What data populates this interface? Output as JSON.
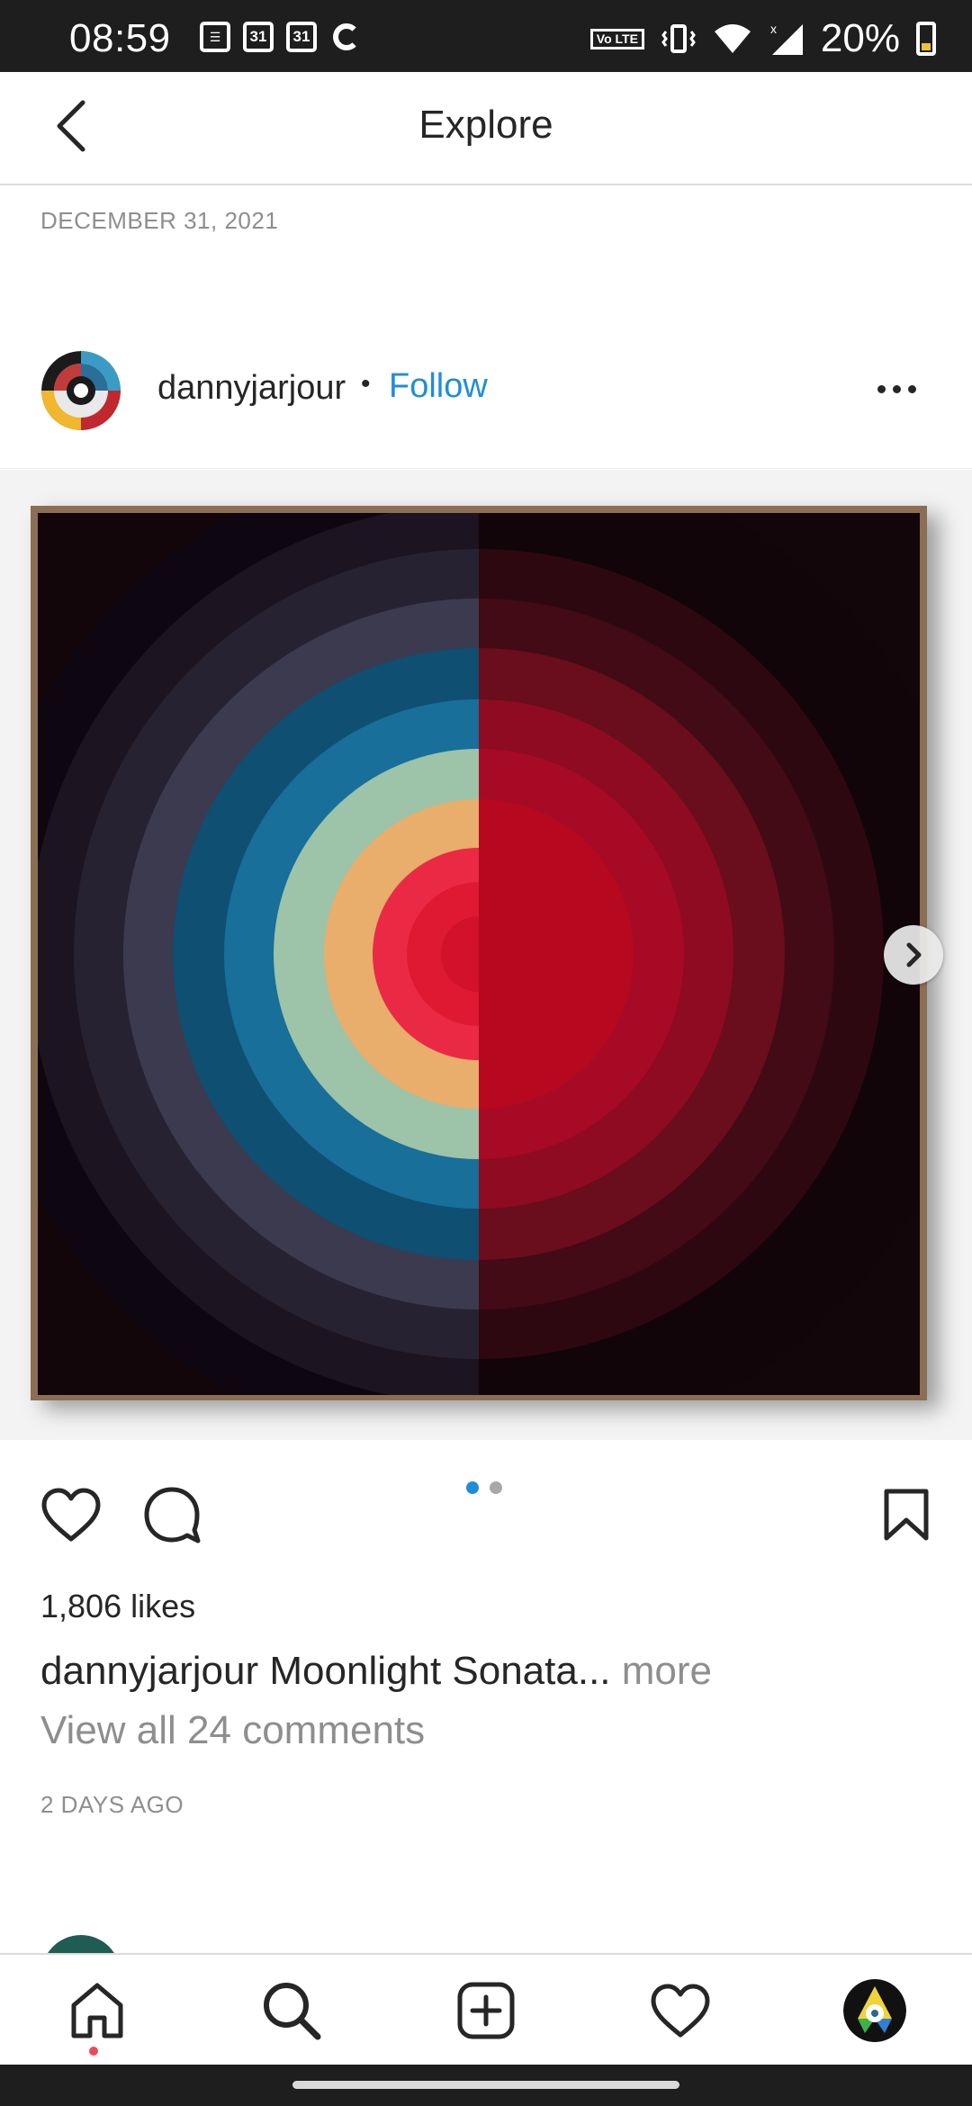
{
  "status_bar": {
    "time": "08:59",
    "calendar_day_1": "31",
    "calendar_day_2": "31",
    "lte_label": "Vo LTE",
    "battery": "20%"
  },
  "header": {
    "title": "Explore"
  },
  "feed": {
    "date": "DECEMBER 31, 2021"
  },
  "post": {
    "username": "dannyjarjour",
    "separator": "•",
    "follow_label": "Follow",
    "carousel": {
      "count": 2,
      "active_index": 0
    },
    "likes": "1,806 likes",
    "caption_user": "dannyjarjour",
    "caption_text": "Moonlight Sonata...",
    "caption_more": "more",
    "view_comments": "View all 24 comments",
    "time_ago": "2 DAYS AGO"
  },
  "bottom_nav": {
    "items": [
      "home-icon",
      "search-icon",
      "new-post-icon",
      "activity-heart-icon",
      "profile-avatar"
    ],
    "active": "home-icon"
  },
  "colors": {
    "accent": "#1f8ed8",
    "notification_dot": "#ed4956",
    "text_primary": "#262626",
    "text_secondary": "#8e8e8e"
  }
}
